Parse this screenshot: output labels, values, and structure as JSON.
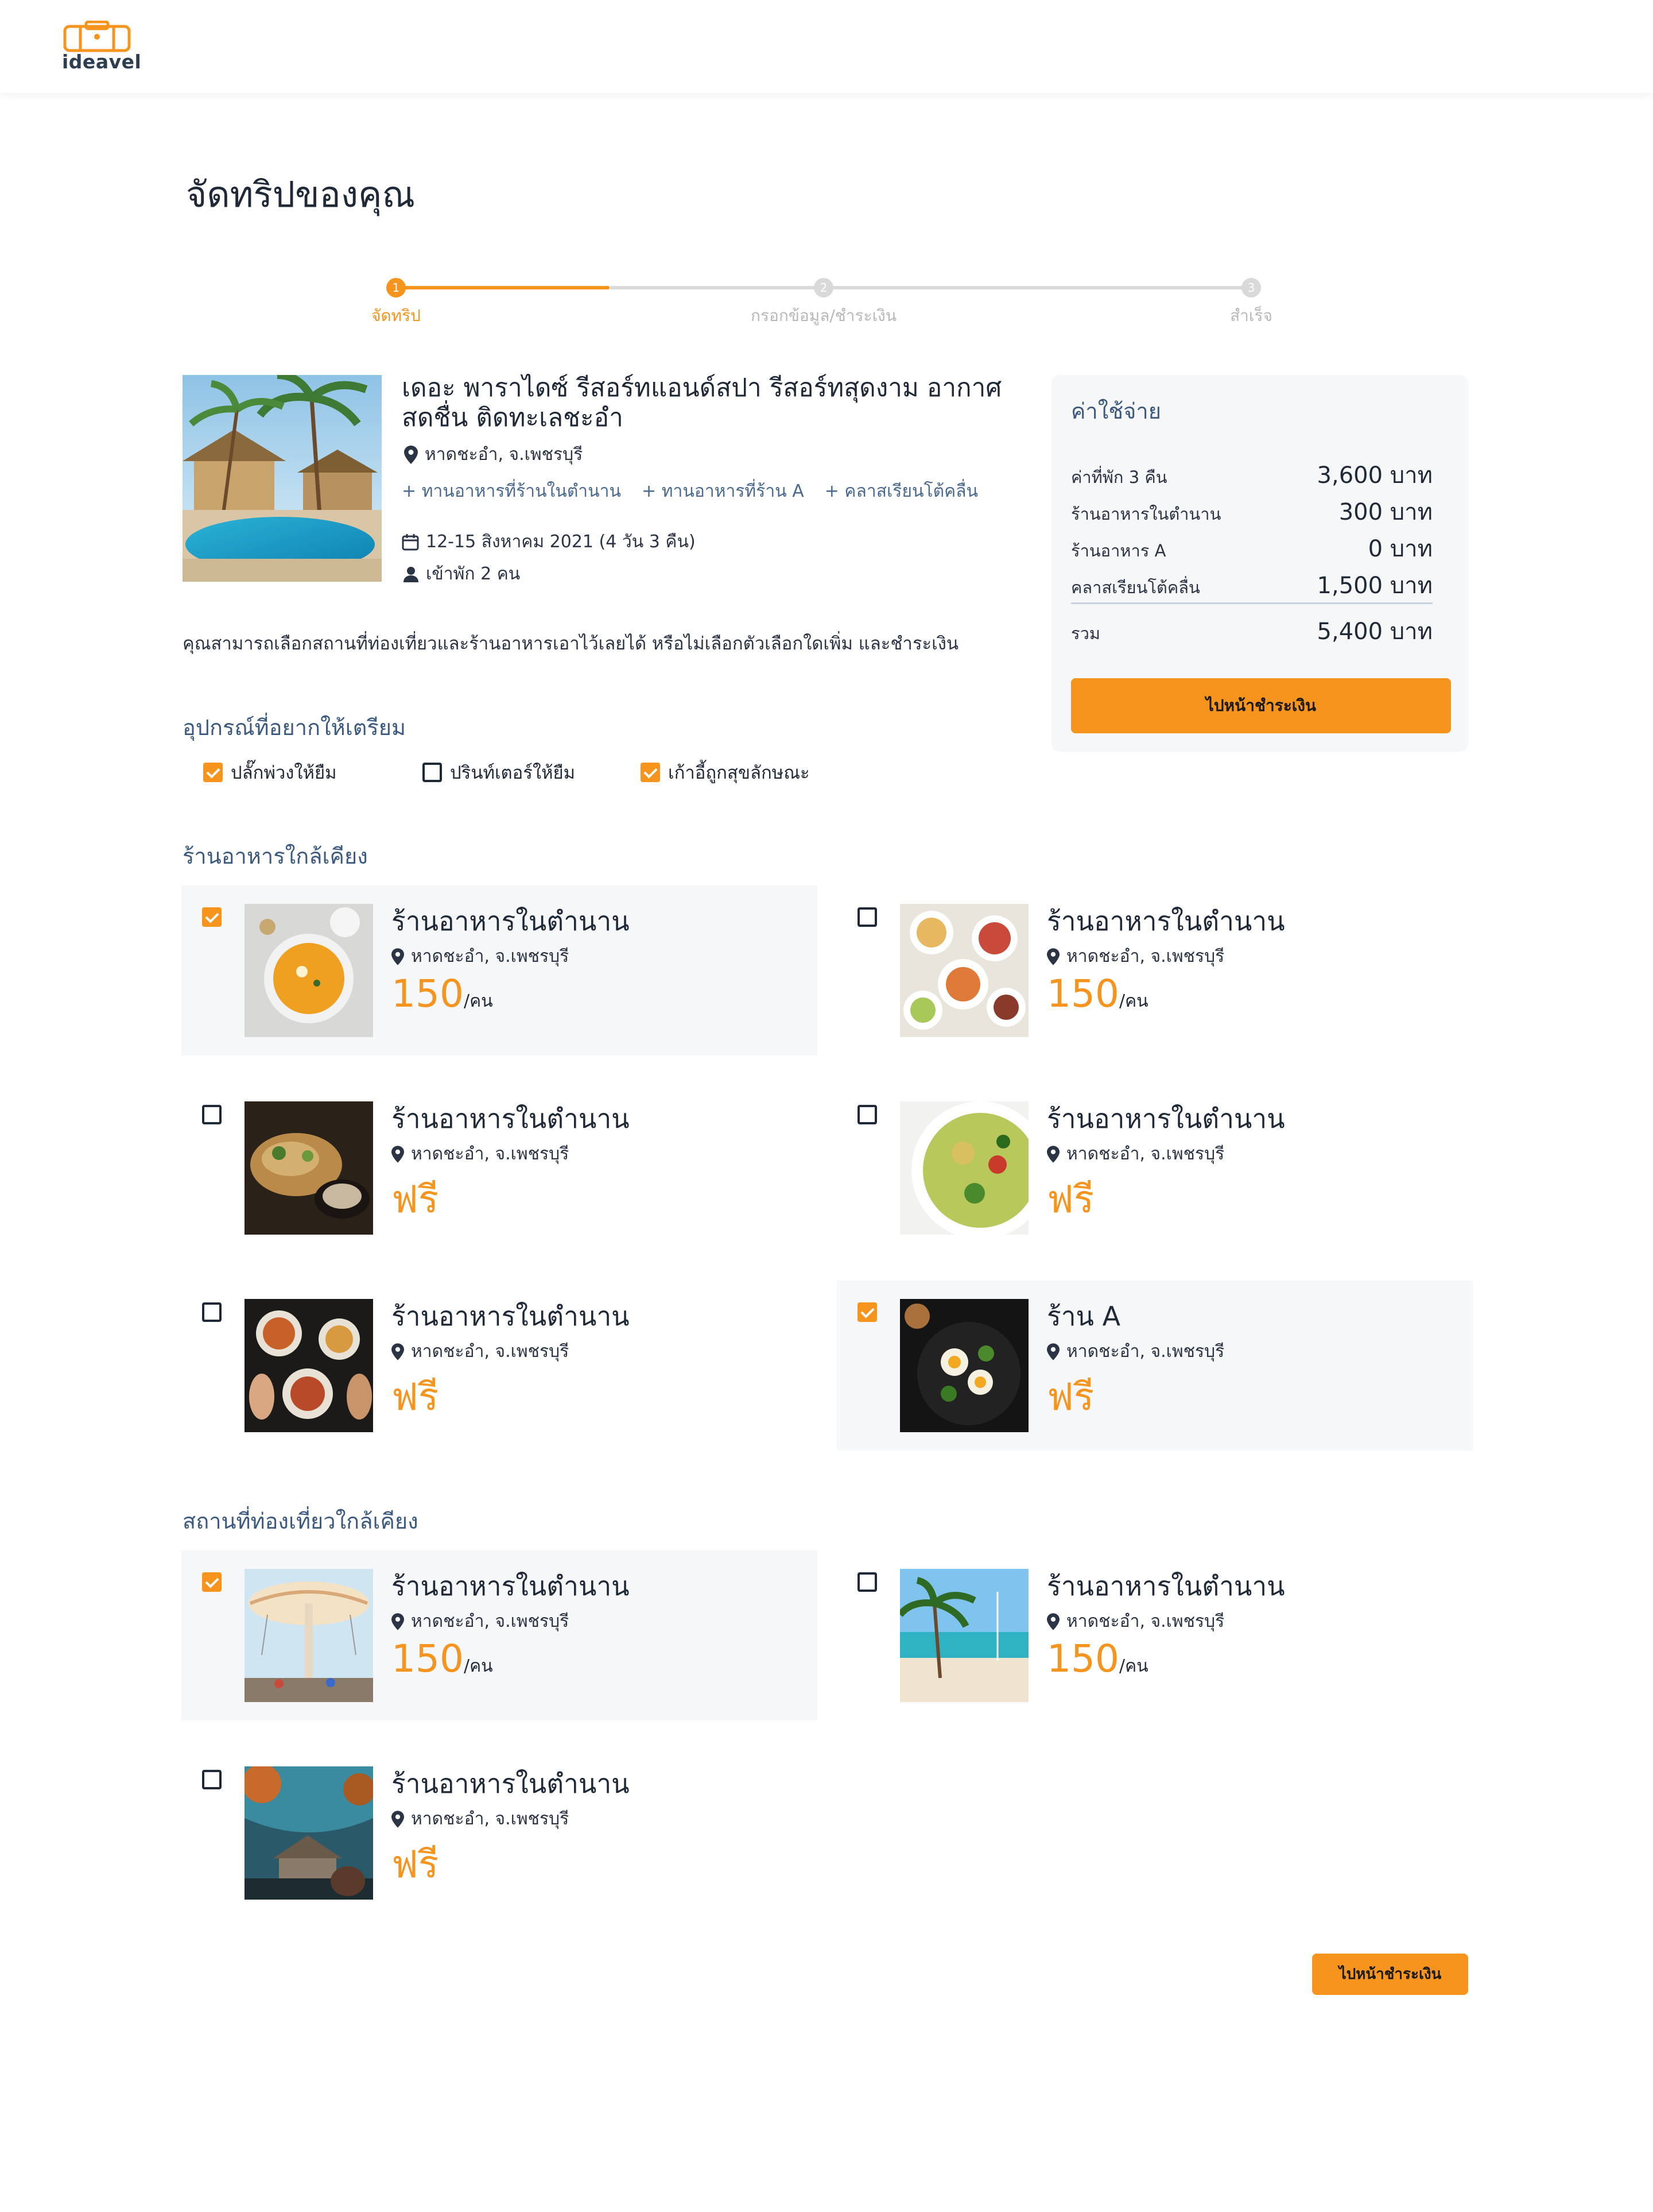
{
  "brand": {
    "name": "ideavel",
    "accent": "#f7941d",
    "heading_color": "#3c5a80"
  },
  "page_title": "จัดทริปของคุณ",
  "stepper": {
    "steps": [
      {
        "num": "1",
        "label": "จัดทริป",
        "state": "active"
      },
      {
        "num": "2",
        "label": "กรอกข้อมูล/ชำระเงิน",
        "state": "inactive"
      },
      {
        "num": "3",
        "label": "สำเร็จ",
        "state": "inactive"
      }
    ]
  },
  "hotel": {
    "title": "เดอะ พาราไดซ์ รีสอร์ทแอนด์สปา รีสอร์ทสุดงาม อากาศสดชื่น ติดทะเลชะอำ",
    "location": "หาดชะอำ, จ.เพชรบุรี",
    "addons": [
      "ทานอาหารที่ร้านในตำนาน",
      "ทานอาหารที่ร้าน A",
      "คลาสเรียนโต้คลื่น"
    ],
    "dates": "12-15 สิงหาคม 2021 (4 วัน 3 คืน)",
    "guests": "เข้าพัก 2 คน",
    "calendar_icon": "calendar-icon",
    "user_icon": "user-icon",
    "pin_icon": "map-pin-icon"
  },
  "intro_text": "คุณสามารถเลือกสถานที่ท่องเที่ยวและร้านอาหารเอาไว้เลยได้ หรือไม่เลือกตัวเลือกใดเพิ่ม และชำระเงิน",
  "cost": {
    "title": "ค่าใช้จ่าย",
    "rows": [
      {
        "label": "ค่าที่พัก 3 คืน",
        "amount": "3,600 บาท"
      },
      {
        "label": "ร้านอาหารในตำนาน",
        "amount": "300 บาท"
      },
      {
        "label": "ร้านอาหาร A",
        "amount": "0 บาท"
      },
      {
        "label": "คลาสเรียนโต้คลื่น",
        "amount": "1,500 บาท"
      }
    ],
    "total_label": "รวม",
    "total_amount": "5,400 บาท",
    "button": "ไปหน้าชำระเงิน"
  },
  "equipment": {
    "title": "อุปกรณ์ที่อยากให้เตรียม",
    "items": [
      {
        "label": "ปลั๊กพ่วงให้ยืม",
        "checked": true
      },
      {
        "label": "ปรินท์เตอร์ให้ยืม",
        "checked": false
      },
      {
        "label": "เก้าอี้ถูกสุขลักษณะ",
        "checked": true
      }
    ]
  },
  "restaurants": {
    "title": "ร้านอาหารใกล้เคียง",
    "items": [
      {
        "name": "ร้านอาหารในตำนาน",
        "location": "หาดชะอำ, จ.เพชรบุรี",
        "price": "150",
        "unit": "/คน",
        "checked": true
      },
      {
        "name": "ร้านอาหารในตำนาน",
        "location": "หาดชะอำ, จ.เพชรบุรี",
        "price": "150",
        "unit": "/คน",
        "checked": false
      },
      {
        "name": "ร้านอาหารในตำนาน",
        "location": "หาดชะอำ, จ.เพชรบุรี",
        "price": "ฟรี",
        "unit": "",
        "checked": false
      },
      {
        "name": "ร้านอาหารในตำนาน",
        "location": "หาดชะอำ, จ.เพชรบุรี",
        "price": "ฟรี",
        "unit": "",
        "checked": false
      },
      {
        "name": "ร้านอาหารในตำนาน",
        "location": "หาดชะอำ, จ.เพชรบุรี",
        "price": "ฟรี",
        "unit": "",
        "checked": false
      },
      {
        "name": "ร้าน A",
        "location": "หาดชะอำ, จ.เพชรบุรี",
        "price": "ฟรี",
        "unit": "",
        "checked": true
      }
    ]
  },
  "attractions": {
    "title": "สถานที่ท่องเที่ยวใกล้เคียง",
    "items": [
      {
        "name": "ร้านอาหารในตำนาน",
        "location": "หาดชะอำ, จ.เพชรบุรี",
        "price": "150",
        "unit": "/คน",
        "checked": true
      },
      {
        "name": "ร้านอาหารในตำนาน",
        "location": "หาดชะอำ, จ.เพชรบุรี",
        "price": "150",
        "unit": "/คน",
        "checked": false
      },
      {
        "name": "ร้านอาหารในตำนาน",
        "location": "หาดชะอำ, จ.เพชรบุรี",
        "price": "ฟรี",
        "unit": "",
        "checked": false
      }
    ]
  },
  "bottom_button": "ไปหน้าชำระเงิน"
}
